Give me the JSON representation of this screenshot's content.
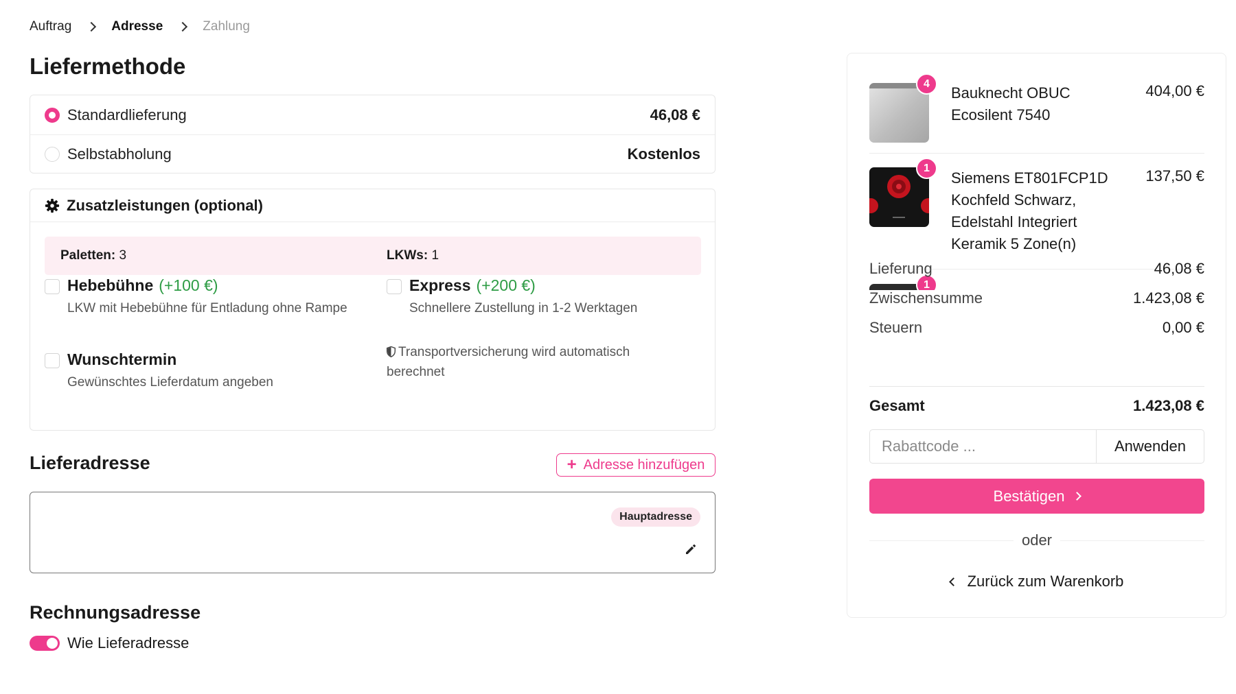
{
  "breadcrumb": {
    "step1": "Auftrag",
    "step2": "Adresse",
    "step3": "Zahlung"
  },
  "delivery": {
    "title": "Liefermethode",
    "options": [
      {
        "name": "Standardlieferung",
        "price": "46,08 €",
        "selected": true
      },
      {
        "name": "Selbstabholung",
        "price": "Kostenlos",
        "selected": false
      }
    ]
  },
  "extras": {
    "title": "Zusatzleistungen (optional)",
    "pallets_label": "Paletten:",
    "pallets_value": "3",
    "trucks_label": "LKWs:",
    "trucks_value": "1",
    "options": [
      {
        "title": "Hebebühne",
        "price": "(+100 €)",
        "description": "LKW mit Hebebühne für Entladung ohne Rampe"
      },
      {
        "title": "Express",
        "price": "(+200 €)",
        "description": "Schnellere Zustellung in 1-2 Werktagen"
      },
      {
        "title": "Wunschtermin",
        "description": "Gewünschtes Lieferdatum angeben"
      }
    ],
    "insurance_note": "Transportversicherung wird automatisch berechnet"
  },
  "shipping_address": {
    "title": "Lieferadresse",
    "add_button": "Adresse hinzufügen",
    "badge": "Hauptadresse"
  },
  "billing": {
    "title": "Rechnungsadresse",
    "same_as_shipping": "Wie Lieferadresse",
    "same_as_shipping_on": true
  },
  "summary": {
    "items": [
      {
        "title": "Bauknecht OBUC Ecosilent 7540",
        "price": "404,00 €",
        "qty": "4"
      },
      {
        "title": "Siemens ET801FCP1D Kochfeld Schwarz, Edelstahl Integriert Keramik 5 Zone(n)",
        "price": "137,50 €",
        "qty": "1"
      },
      {
        "qty": "1"
      }
    ],
    "delivery_label": "Lieferung",
    "delivery_value": "46,08 €",
    "subtotal_label": "Zwischensumme",
    "subtotal_value": "1.423,08 €",
    "tax_label": "Steuern",
    "tax_value": "0,00 €",
    "total_label": "Gesamt",
    "total_value": "1.423,08 €",
    "coupon_placeholder": "Rabattcode ...",
    "apply_label": "Anwenden",
    "confirm_label": "Bestätigen",
    "or_label": "oder",
    "back_label": "Zurück zum Warenkorb"
  },
  "colors": {
    "accent": "#ee3a8c",
    "button": "#f2468e",
    "success": "#2e9c45",
    "info_bg": "#fdeef3"
  }
}
